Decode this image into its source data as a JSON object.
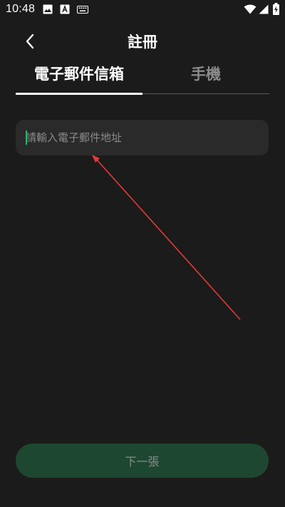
{
  "status_bar": {
    "time": "10:48",
    "icons": [
      "image-icon",
      "text-recognition-icon",
      "keyboard-icon",
      "wifi-icon",
      "signal-icon",
      "battery-charging-icon"
    ]
  },
  "header": {
    "back_icon": "chevron-left-icon",
    "title": "註冊"
  },
  "tabs": [
    {
      "label": "電子郵件信箱",
      "active": true
    },
    {
      "label": "手機",
      "active": false
    }
  ],
  "email_input": {
    "value": "",
    "placeholder": "請輸入電子郵件地址"
  },
  "next_button": {
    "label": "下一張"
  },
  "colors": {
    "background": "#1b1b1b",
    "input_background": "#2a2a2a",
    "button_background": "#1e4731",
    "caret": "#2fb36b",
    "annotation_arrow": "#e53935",
    "inactive_text": "#8a8a8a"
  }
}
